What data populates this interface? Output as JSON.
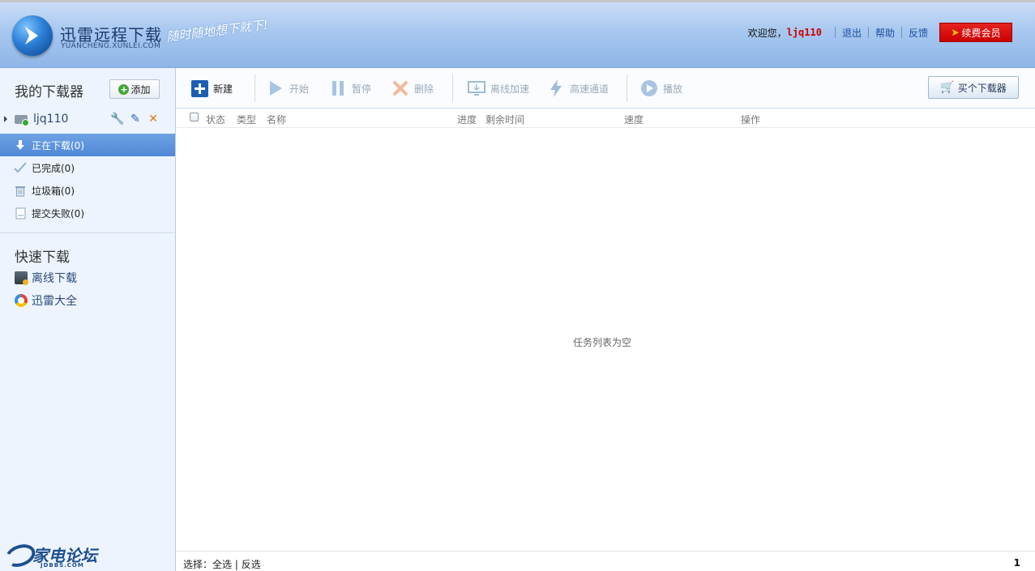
{
  "header": {
    "logo_title": "迅雷远程下载",
    "logo_subtitle": "YUANCHENG.XUNLEI.COM",
    "slogan": "随时随地想下就下!",
    "welcome": "欢迎您，",
    "username": "ljq110",
    "links": [
      "退出",
      "帮助",
      "反馈"
    ],
    "vip_button": "续费会员"
  },
  "sidebar": {
    "my_downloaders_title": "我的下载器",
    "add_button": "添加",
    "device_name": "ljq110",
    "nav": [
      {
        "label": "正在下载(0)",
        "icon": "download-arrow-icon",
        "active": true
      },
      {
        "label": "已完成(0)",
        "icon": "checkmark-icon",
        "active": false
      },
      {
        "label": "垃圾箱(0)",
        "icon": "trash-icon",
        "active": false
      },
      {
        "label": "提交失败(0)",
        "icon": "failed-doc-icon",
        "active": false
      }
    ],
    "quick_title": "快速下载",
    "quick_items": [
      {
        "label": "离线下载",
        "icon": "offline-download-icon"
      },
      {
        "label": "迅雷大全",
        "icon": "xunlei-daquan-icon"
      }
    ],
    "brand_text": "家电论坛",
    "brand_sub": "JDBBS.COM"
  },
  "toolbar": {
    "new": "新建",
    "start": "开始",
    "pause": "暂停",
    "delete": "删除",
    "offline_accel": "离线加速",
    "high_speed": "高速通道",
    "play": "播放",
    "buy": "买个下载器"
  },
  "table": {
    "columns": [
      "状态",
      "类型",
      "名称",
      "进度",
      "剩余时间",
      "速度",
      "操作"
    ],
    "rows": [],
    "empty_message": "任务列表为空"
  },
  "footer": {
    "select_label": "选择：",
    "select_all": "全选",
    "invert": "反选",
    "page": "1"
  },
  "colors": {
    "header_gradient_top": "#c9ddf6",
    "header_gradient_bottom": "#8fb6e8",
    "active_nav": "#5a92dc",
    "username": "#cc0000",
    "vip_button": "#d60000"
  }
}
